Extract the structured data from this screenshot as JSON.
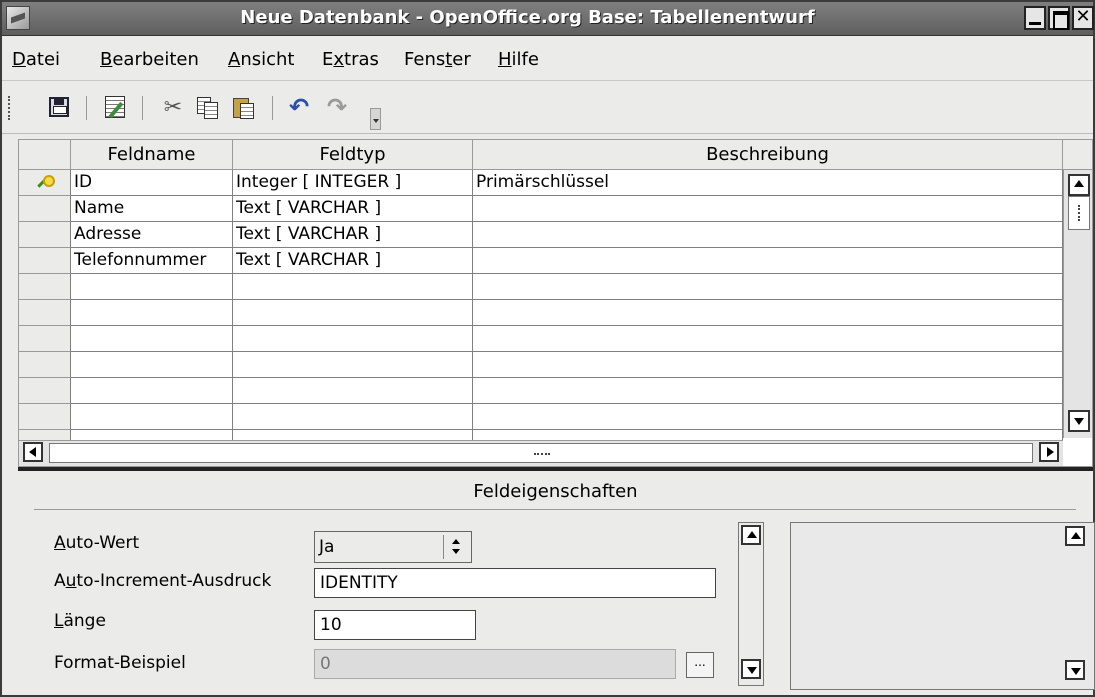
{
  "window": {
    "title": "Neue Datenbank - OpenOffice.org Base: Tabellenentwurf"
  },
  "menubar": {
    "items": [
      {
        "pre": "",
        "acc": "D",
        "post": "atei"
      },
      {
        "pre": "",
        "acc": "B",
        "post": "earbeiten"
      },
      {
        "pre": "",
        "acc": "A",
        "post": "nsicht"
      },
      {
        "pre": "E",
        "acc": "x",
        "post": "tras"
      },
      {
        "pre": "Fens",
        "acc": "t",
        "post": "er"
      },
      {
        "pre": "",
        "acc": "H",
        "post": "ilfe"
      }
    ]
  },
  "toolbar": {
    "icons": [
      "save-icon",
      "edit-icon",
      "cut-icon",
      "copy-icon",
      "paste-icon",
      "undo-icon",
      "redo-icon"
    ],
    "cut_glyph": "✂",
    "undo_glyph": "↶",
    "redo_glyph": "↷"
  },
  "grid": {
    "columns": [
      "Feldname",
      "Feldtyp",
      "Beschreibung"
    ],
    "rows": [
      {
        "name": "ID",
        "type": "Integer [ INTEGER ]",
        "desc": "Primärschlüssel",
        "primary_key": true
      },
      {
        "name": "Name",
        "type": "Text [ VARCHAR ]",
        "desc": ""
      },
      {
        "name": "Adresse",
        "type": "Text [ VARCHAR ]",
        "desc": ""
      },
      {
        "name": "Telefonnummer",
        "type": "Text [ VARCHAR ]",
        "desc": ""
      },
      {
        "name": "",
        "type": "",
        "desc": ""
      },
      {
        "name": "",
        "type": "",
        "desc": ""
      },
      {
        "name": "",
        "type": "",
        "desc": ""
      },
      {
        "name": "",
        "type": "",
        "desc": ""
      },
      {
        "name": "",
        "type": "",
        "desc": ""
      },
      {
        "name": "",
        "type": "",
        "desc": ""
      },
      {
        "name": "",
        "type": "",
        "desc": ""
      }
    ]
  },
  "properties": {
    "title": "Feldeigenschaften",
    "auto_wert": {
      "label_acc": "A",
      "label_rest": "uto-Wert",
      "value": "Ja"
    },
    "auto_increment": {
      "label_pre": "A",
      "label_acc": "u",
      "label_rest": "to-Increment-Ausdruck",
      "value": "IDENTITY"
    },
    "laenge": {
      "label_acc": "L",
      "label_rest": "änge",
      "value": "10"
    },
    "format": {
      "label": "Format-Beispiel",
      "value": "0",
      "button": "..."
    }
  },
  "colors": {
    "titlebar": "#6a6a6a",
    "window_bg": "#ebebea",
    "key_icon": "#3a8a1f"
  }
}
